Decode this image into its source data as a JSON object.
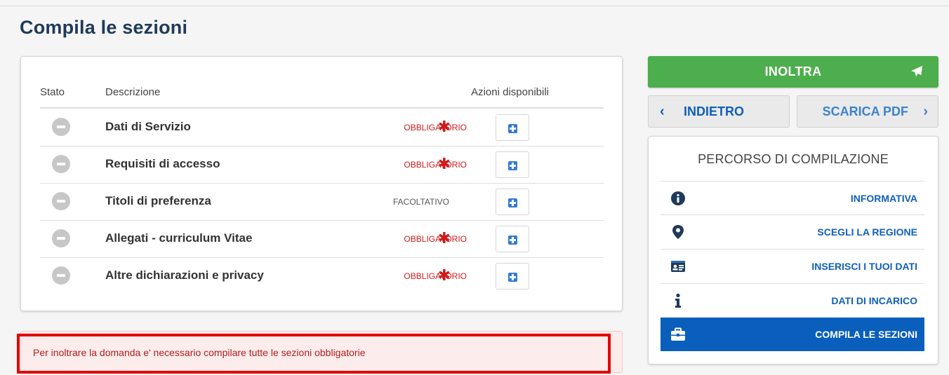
{
  "page": {
    "title": "Compila le sezioni"
  },
  "table": {
    "headers": {
      "stato": "Stato",
      "descrizione": "Descrizione",
      "azioni": "Azioni disponibili"
    },
    "rows": [
      {
        "label": "Dati di Servizio",
        "status": "OBBLIGATORIO",
        "required": true
      },
      {
        "label": "Requisiti di accesso",
        "status": "OBBLIGATORIO",
        "required": true
      },
      {
        "label": "Titoli di preferenza",
        "status": "FACOLTATIVO",
        "required": false
      },
      {
        "label": "Allegati - curriculum Vitae",
        "status": "OBBLIGATORIO",
        "required": true
      },
      {
        "label": "Altre dichiarazioni e privacy",
        "status": "OBBLIGATORIO",
        "required": true
      }
    ],
    "asterisk": "✱"
  },
  "alert": {
    "text": "Per inoltrare la domanda e' necessario compilare tutte le sezioni obbligatorie"
  },
  "actions": {
    "inoltra": "INOLTRA",
    "indietro": "INDIETRO",
    "scarica_pdf": "SCARICA PDF",
    "chevron_left": "‹",
    "chevron_right": "›"
  },
  "path": {
    "title": "PERCORSO DI COMPILAZIONE",
    "items": [
      {
        "label": "INFORMATIVA",
        "icon": "info-circle-icon"
      },
      {
        "label": "SCEGLI LA REGIONE",
        "icon": "map-marker-icon"
      },
      {
        "label": "INSERISCI I TUOI DATI",
        "icon": "id-card-icon"
      },
      {
        "label": "DATI DI INCARICO",
        "icon": "info-icon"
      },
      {
        "label": "COMPILA LE SEZIONI",
        "icon": "briefcase-icon",
        "active": true
      }
    ]
  },
  "colors": {
    "primary": "#1060b8",
    "success": "#4cae4c",
    "danger": "#d11a1a",
    "active": "#0a5fbd"
  }
}
